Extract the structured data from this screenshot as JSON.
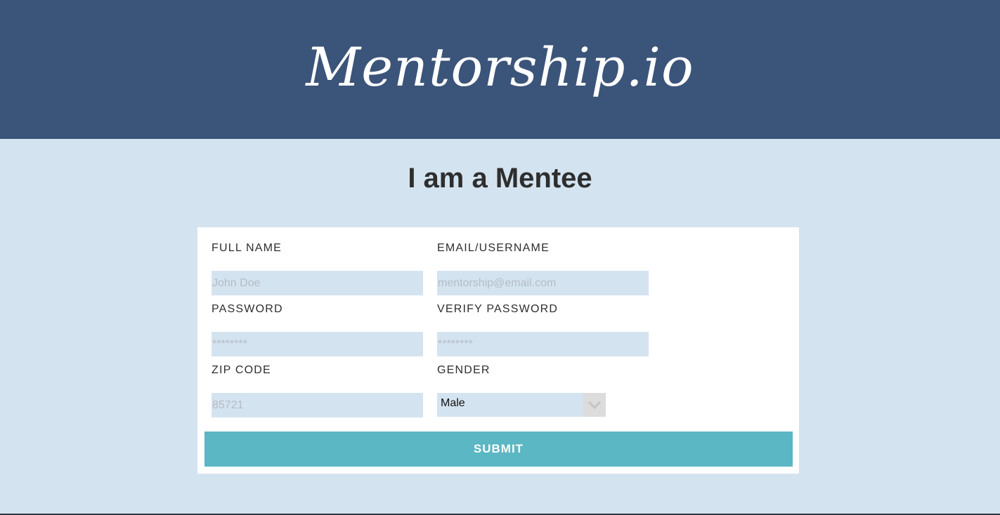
{
  "header": {
    "logo_text": "Mentorship.io"
  },
  "page": {
    "title": "I am a Mentee"
  },
  "form": {
    "full_name": {
      "label": "FULL NAME",
      "placeholder": "John Doe"
    },
    "email": {
      "label": "EMAIL/USERNAME",
      "placeholder": "mentorship@email.com"
    },
    "password": {
      "label": "PASSWORD",
      "placeholder": "********"
    },
    "verify_password": {
      "label": "VERIFY PASSWORD",
      "placeholder": "********"
    },
    "zip": {
      "label": "ZIP CODE",
      "placeholder": "85721"
    },
    "gender": {
      "label": "GENDER",
      "value": "Male"
    },
    "submit_label": "SUBMIT"
  },
  "icons": {
    "select_arrow": "chevron-down-icon"
  },
  "colors": {
    "header_bg": "#3b5479",
    "page_bg": "#d4e3f0",
    "input_bg": "#d4e3f0",
    "submit_bg": "#5ab7c3"
  }
}
